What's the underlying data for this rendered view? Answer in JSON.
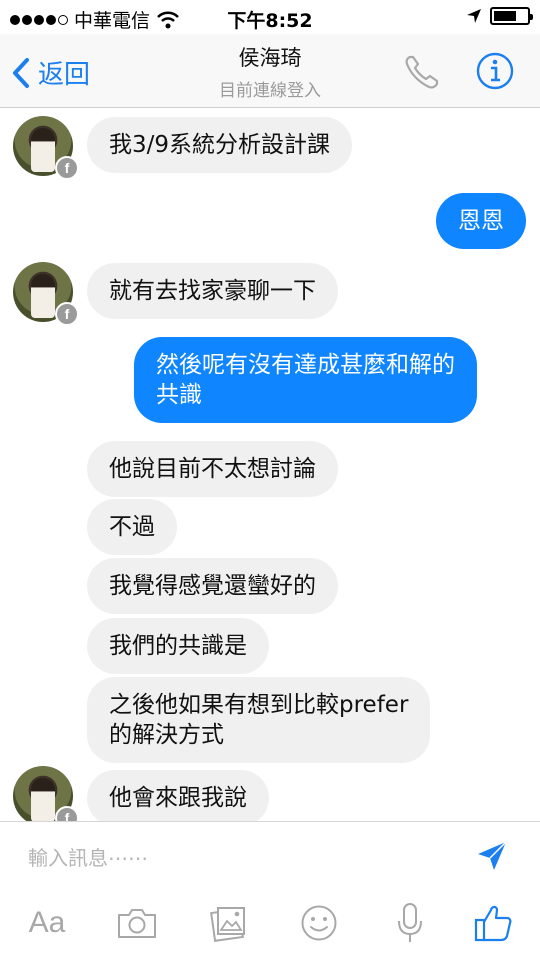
{
  "status_bar": {
    "carrier": "中華電信",
    "time": "下午8:52"
  },
  "navbar": {
    "back_label": "返回",
    "title": "侯海琦",
    "subtitle": "目前連線登入"
  },
  "messages": [
    {
      "direction": "in",
      "text": "我3/9系統分析設計課"
    },
    {
      "direction": "out",
      "text": "恩恩"
    },
    {
      "direction": "in",
      "text": "就有去找家豪聊一下"
    },
    {
      "direction": "out",
      "text": "然後呢有沒有達成甚麼和解的\n共識"
    },
    {
      "direction": "in",
      "text": "他說目前不太想討論"
    },
    {
      "direction": "in",
      "text": "不過"
    },
    {
      "direction": "in",
      "text": "我覺得感覺還蠻好的"
    },
    {
      "direction": "in",
      "text": "我們的共識是"
    },
    {
      "direction": "in",
      "text": "之後他如果有想到比較prefer\n的解決方式"
    },
    {
      "direction": "in",
      "text": "他會來跟我說"
    }
  ],
  "composer": {
    "placeholder": "輸入訊息⋯⋯",
    "text_tool_label": "Aa"
  },
  "colors": {
    "accent": "#1b7ff0",
    "outgoing_bubble": "#0f85ff",
    "incoming_bubble": "#f1f0f0"
  },
  "icons": [
    "signal-icon",
    "wifi-icon",
    "location-icon",
    "battery-icon",
    "back-chevron-icon",
    "phone-icon",
    "info-icon",
    "facebook-badge-icon",
    "send-icon",
    "camera-icon",
    "photo-gallery-icon",
    "emoji-icon",
    "microphone-icon",
    "like-icon"
  ]
}
